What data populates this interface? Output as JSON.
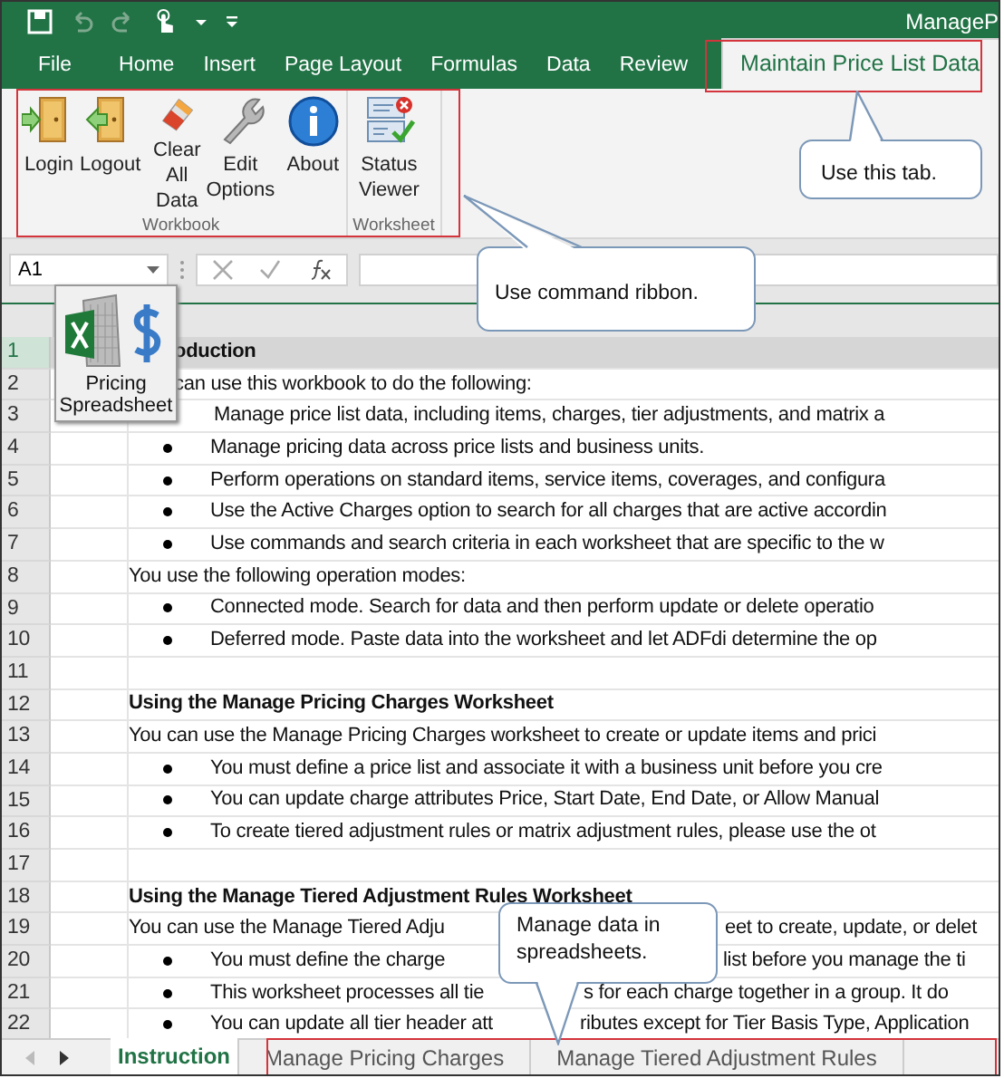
{
  "title_bar": {
    "title": "ManageP"
  },
  "ribbon_tabs": [
    {
      "label": "File",
      "selected": false
    },
    {
      "label": "Home",
      "selected": false
    },
    {
      "label": "Insert",
      "selected": false
    },
    {
      "label": "Page Layout",
      "selected": false
    },
    {
      "label": "Formulas",
      "selected": false
    },
    {
      "label": "Data",
      "selected": false
    },
    {
      "label": "Review",
      "selected": false
    },
    {
      "label": "Maintain Price List Data",
      "selected": true
    }
  ],
  "ribbon_groups": [
    {
      "label": "Workbook",
      "buttons": [
        {
          "kind": "login",
          "label": "Login"
        },
        {
          "kind": "logout",
          "label": "Logout"
        },
        {
          "kind": "clear",
          "label": "Clear All Data"
        },
        {
          "kind": "edit",
          "label": "Edit Options"
        },
        {
          "kind": "about",
          "label": "About"
        }
      ]
    },
    {
      "label": "Worksheet",
      "buttons": [
        {
          "kind": "status",
          "label": "Status Viewer"
        }
      ]
    }
  ],
  "formula_bar": {
    "name_box": "A1"
  },
  "floating_button": {
    "label": "Pricing Spreadsheet"
  },
  "rows": [
    {
      "number": "1",
      "kind": "banner",
      "selected": true,
      "covered_start": true,
      "segments": [
        "oduction"
      ]
    },
    {
      "number": "2",
      "kind": "text",
      "selected": false,
      "covered_start": true,
      "segments": [
        "can use this workbook to do the following:"
      ]
    },
    {
      "number": "3",
      "kind": "indent",
      "selected": false,
      "segments": [
        "Manage price list data, including items, charges, tier adjustments, and matrix a"
      ]
    },
    {
      "number": "4",
      "kind": "bullet",
      "selected": false,
      "segments": [
        "Manage pricing data across price lists and business units."
      ]
    },
    {
      "number": "5",
      "kind": "bullet",
      "selected": false,
      "segments": [
        "Perform operations on standard items, service items, coverages, and configura"
      ]
    },
    {
      "number": "6",
      "kind": "bullet",
      "selected": false,
      "segments": [
        "Use the Active Charges option to search for all charges that are active accordin"
      ]
    },
    {
      "number": "7",
      "kind": "bullet",
      "selected": false,
      "segments": [
        "Use commands and search criteria in each worksheet that are specific to the w"
      ]
    },
    {
      "number": "8",
      "kind": "text",
      "selected": false,
      "segments": [
        "You use the following operation modes:"
      ]
    },
    {
      "number": "9",
      "kind": "bullet",
      "selected": false,
      "segments": [
        "Connected mode. Search for data and then perform update or delete operatio"
      ]
    },
    {
      "number": "10",
      "kind": "bullet",
      "selected": false,
      "segments": [
        "Deferred mode. Paste data into the worksheet and let ADFdi determine the op"
      ]
    },
    {
      "number": "11",
      "kind": "blank",
      "selected": false
    },
    {
      "number": "12",
      "kind": "heading",
      "selected": false,
      "segments": [
        "Using the Manage Pricing Charges Worksheet"
      ]
    },
    {
      "number": "13",
      "kind": "text",
      "selected": false,
      "segments": [
        "You can use the Manage Pricing Charges worksheet to create or update items and prici"
      ]
    },
    {
      "number": "14",
      "kind": "bullet",
      "selected": false,
      "segments": [
        "You must define a price list and associate it with a business unit before you cre"
      ]
    },
    {
      "number": "15",
      "kind": "bullet",
      "selected": false,
      "segments": [
        "You can update charge attributes Price, Start Date, End Date, or Allow Manual"
      ]
    },
    {
      "number": "16",
      "kind": "bullet",
      "selected": false,
      "segments": [
        "To create tiered adjustment rules or matrix adjustment rules, please use the ot"
      ]
    },
    {
      "number": "17",
      "kind": "blank",
      "selected": false
    },
    {
      "number": "18",
      "kind": "heading",
      "selected": false,
      "segments": [
        "Using the Manage Tiered Adjustment Rules Worksheet"
      ]
    },
    {
      "number": "19",
      "kind": "text",
      "selected": false,
      "segments": [
        "You can use the Manage Tiered Adju",
        "eet to create, update, or delet"
      ]
    },
    {
      "number": "20",
      "kind": "bullet",
      "selected": false,
      "segments": [
        "You must define the charge",
        "list before you manage the ti"
      ]
    },
    {
      "number": "21",
      "kind": "bullet",
      "selected": false,
      "segments": [
        "This worksheet processes all tie",
        "s for each charge together in a group. It do"
      ]
    },
    {
      "number": "22",
      "kind": "bullet",
      "selected": false,
      "segments": [
        "You can update all tier header att",
        "ributes except for Tier Basis Type, Application"
      ]
    }
  ],
  "sheet_tabs": [
    {
      "label": "Instruction",
      "selected": true
    },
    {
      "label": "Manage Pricing Charges",
      "selected": false
    },
    {
      "label": "Manage Tiered Adjustment Rules",
      "selected": false
    }
  ],
  "callouts": [
    {
      "text": "Use this tab."
    },
    {
      "text": "Use command ribbon."
    },
    {
      "text": "Manage data in spreadsheets."
    }
  ]
}
